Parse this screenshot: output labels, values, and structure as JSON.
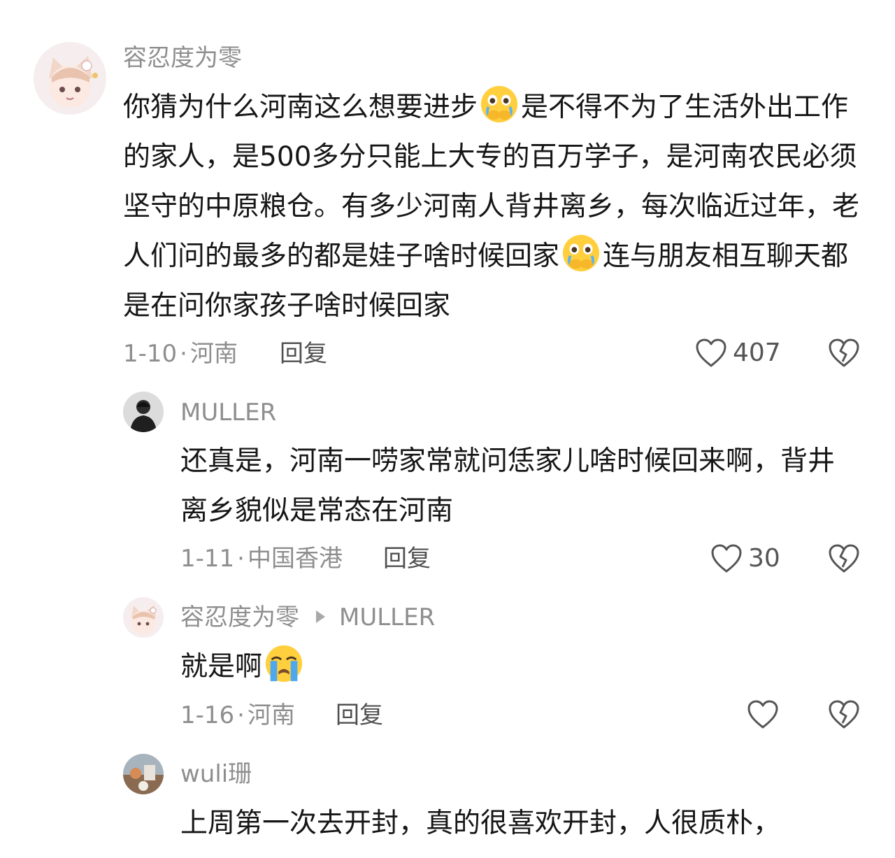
{
  "comments": [
    {
      "username": "容忍度为零",
      "text_before_emoji": "你猜为什么河南这么想要进步",
      "emoji_1": "crying-emoji",
      "text_middle": "是不得不为了生活外出工作的家人，是500多分只能上大专的百万学子，是河南农民必须坚守的中原粮仓。有多少河南人背井离乡，每次临近过年，老人们问的最多的都是娃子啥时候回家",
      "emoji_2": "crying-emoji",
      "text_after": "连与朋友相互聊天都是在问你家孩子啥时候回家",
      "date": "1-10",
      "location": "河南",
      "reply_label": "回复",
      "like_count": "407"
    },
    {
      "username": "MULLER",
      "text": "还真是，河南一唠家常就问恁家儿啥时候回来啊，背井离乡貌似是常态在河南",
      "date": "1-11",
      "location": "中国香港",
      "reply_label": "回复",
      "like_count": "30"
    },
    {
      "username": "容忍度为零",
      "reply_to": "MULLER",
      "text": "就是啊",
      "emoji": "loudly-crying-emoji",
      "date": "1-16",
      "location": "河南",
      "reply_label": "回复",
      "like_count": ""
    },
    {
      "username": "wuli珊",
      "text": "上周第一次去开封，真的很喜欢开封，人很质朴，"
    }
  ],
  "colors": {
    "text": "#161616",
    "meta": "#8e8e8e",
    "icon": "#555555"
  },
  "icons": {
    "like": "heart-outline-icon",
    "dislike": "broken-heart-icon"
  }
}
